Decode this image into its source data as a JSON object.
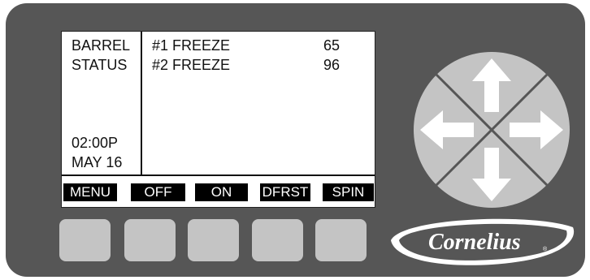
{
  "screen": {
    "left_lines": [
      "BARREL",
      "STATUS",
      "02:00P",
      "MAY 16"
    ],
    "rows": [
      {
        "name": "#1 FREEZE",
        "value": "65"
      },
      {
        "name": "#2 FREEZE",
        "value": "96"
      }
    ],
    "softkeys": [
      "MENU",
      "OFF",
      "ON",
      "DFRST",
      "SPIN"
    ]
  },
  "dpad": {
    "icons": [
      "arrow-up-icon",
      "arrow-down-icon",
      "arrow-left-icon",
      "arrow-right-icon"
    ]
  },
  "brand": {
    "logo": "Cornelius"
  },
  "colors": {
    "panel": "#565656",
    "screen": "#ffffff",
    "softkey_bg": "#000000",
    "button": "#c4c4c4",
    "dpad": "#c4c4c4"
  }
}
